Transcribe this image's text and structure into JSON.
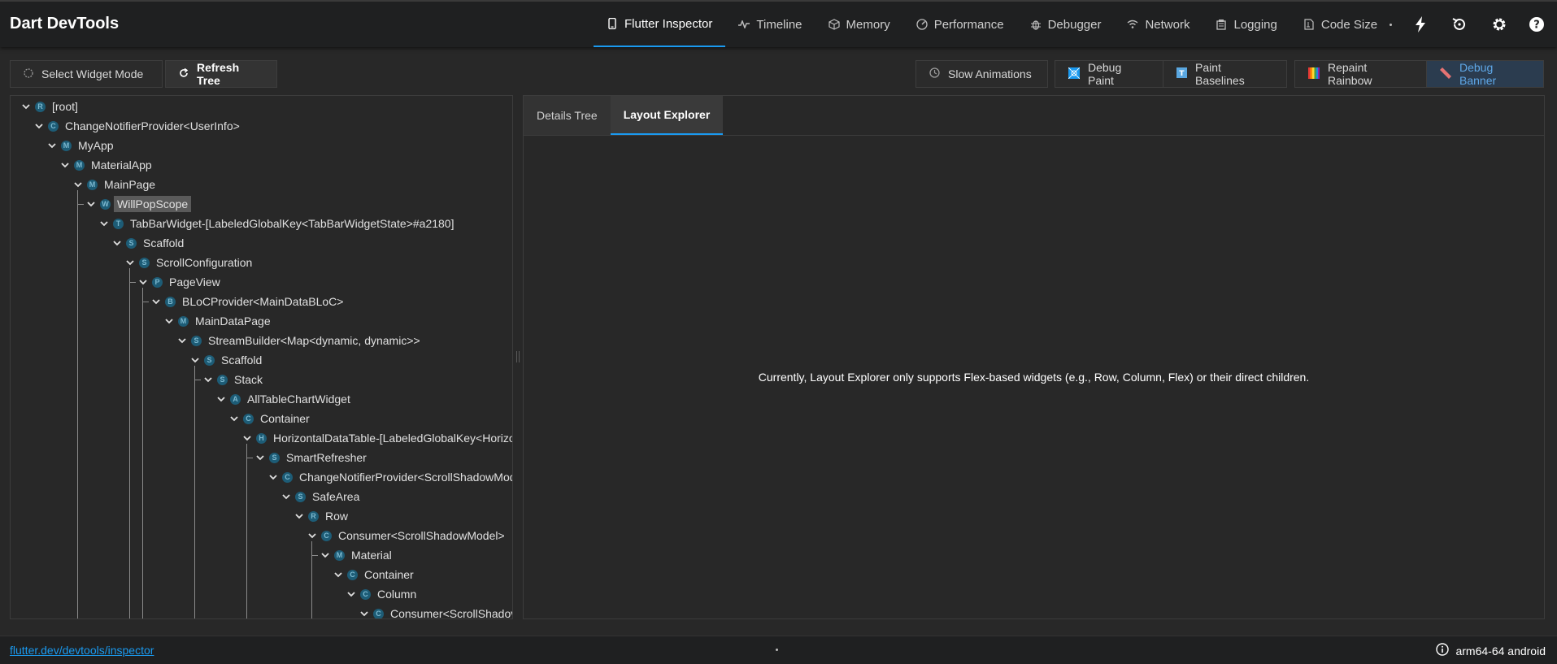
{
  "app": {
    "title": "Dart DevTools"
  },
  "nav": {
    "tabs": [
      {
        "label": "Flutter Inspector",
        "icon": "phone-icon",
        "active": true
      },
      {
        "label": "Timeline",
        "icon": "timeline-icon",
        "active": false
      },
      {
        "label": "Memory",
        "icon": "memory-icon",
        "active": false
      },
      {
        "label": "Performance",
        "icon": "performance-icon",
        "active": false
      },
      {
        "label": "Debugger",
        "icon": "bug-icon",
        "active": false
      },
      {
        "label": "Network",
        "icon": "wifi-icon",
        "active": false
      },
      {
        "label": "Logging",
        "icon": "logging-icon",
        "active": false
      },
      {
        "label": "Code Size",
        "icon": "code-size-icon",
        "active": false
      }
    ],
    "actions": [
      "hot-reload-icon",
      "hot-restart-icon",
      "settings-icon",
      "help-icon"
    ]
  },
  "toolbar": {
    "select_widget_mode": "Select Widget Mode",
    "refresh_tree": "Refresh Tree",
    "slow_animations": "Slow Animations",
    "debug_paint": "Debug Paint",
    "paint_baselines": "Paint Baselines",
    "repaint_rainbow": "Repaint Rainbow",
    "debug_banner": "Debug Banner"
  },
  "tree": {
    "selected": "WillPopScope",
    "nodes": [
      {
        "label": "[root]",
        "depth": 0,
        "icon_letter": "R"
      },
      {
        "label": "ChangeNotifierProvider<UserInfo>",
        "depth": 1,
        "icon_letter": "C"
      },
      {
        "label": "MyApp",
        "depth": 2,
        "icon_letter": "M"
      },
      {
        "label": "MaterialApp",
        "depth": 3,
        "icon_letter": "M"
      },
      {
        "label": "MainPage",
        "depth": 4,
        "icon_letter": "M"
      },
      {
        "label": "WillPopScope",
        "depth": 5,
        "icon_letter": "W"
      },
      {
        "label": "TabBarWidget-[LabeledGlobalKey<TabBarWidgetState>#a2180]",
        "depth": 6,
        "icon_letter": "T"
      },
      {
        "label": "Scaffold",
        "depth": 7,
        "icon_letter": "S"
      },
      {
        "label": "ScrollConfiguration",
        "depth": 8,
        "icon_letter": "S"
      },
      {
        "label": "PageView",
        "depth": 9,
        "icon_letter": "P"
      },
      {
        "label": "BLoCProvider<MainDataBLoC>",
        "depth": 10,
        "icon_letter": "B"
      },
      {
        "label": "MainDataPage",
        "depth": 11,
        "icon_letter": "M"
      },
      {
        "label": "StreamBuilder<Map<dynamic, dynamic>>",
        "depth": 12,
        "icon_letter": "S"
      },
      {
        "label": "Scaffold",
        "depth": 13,
        "icon_letter": "S"
      },
      {
        "label": "Stack",
        "depth": 14,
        "icon_letter": "S"
      },
      {
        "label": "AllTableChartWidget",
        "depth": 15,
        "icon_letter": "A"
      },
      {
        "label": "Container",
        "depth": 16,
        "icon_letter": "C"
      },
      {
        "label": "HorizontalDataTable-[LabeledGlobalKey<Horizo",
        "depth": 17,
        "icon_letter": "H"
      },
      {
        "label": "SmartRefresher",
        "depth": 18,
        "icon_letter": "S"
      },
      {
        "label": "ChangeNotifierProvider<ScrollShadowMod",
        "depth": 19,
        "icon_letter": "C"
      },
      {
        "label": "SafeArea",
        "depth": 20,
        "icon_letter": "S"
      },
      {
        "label": "Row",
        "depth": 21,
        "icon_letter": "R"
      },
      {
        "label": "Consumer<ScrollShadowModel>",
        "depth": 22,
        "icon_letter": "C"
      },
      {
        "label": "Material",
        "depth": 23,
        "icon_letter": "M"
      },
      {
        "label": "Container",
        "depth": 24,
        "icon_letter": "C"
      },
      {
        "label": "Column",
        "depth": 25,
        "icon_letter": "C"
      },
      {
        "label": "Consumer<ScrollShadov",
        "depth": 26,
        "icon_letter": "C"
      }
    ]
  },
  "details": {
    "tabs": [
      {
        "label": "Details Tree",
        "active": false
      },
      {
        "label": "Layout Explorer",
        "active": true
      }
    ],
    "message": "Currently, Layout Explorer only supports Flex-based widgets (e.g., Row, Column, Flex) or their direct children."
  },
  "status": {
    "link": "flutter.dev/devtools/inspector",
    "device": "arm64-64 android"
  },
  "colors": {
    "accent": "#1a9af0",
    "background": "#282828",
    "topbar": "#1f2021",
    "widget_icon": "#1d5c76"
  }
}
